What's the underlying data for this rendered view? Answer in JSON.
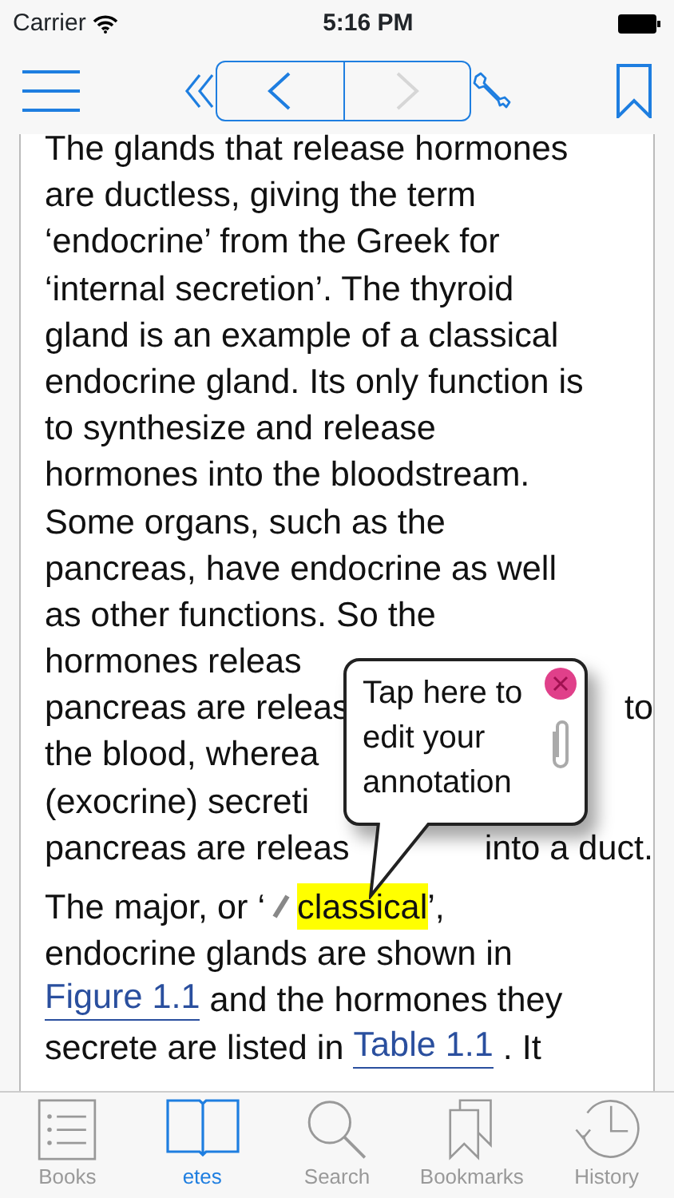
{
  "status_bar": {
    "carrier": "Carrier",
    "time": "5:16 PM"
  },
  "toolbar": {
    "back_button": {
      "disabled": false
    },
    "forward_button": {
      "disabled": true
    }
  },
  "article": {
    "paragraphs": [
      {
        "lines": [
          [
            {
              "kind": "text",
              "text": "The glands that release hormones"
            }
          ],
          [
            {
              "kind": "text",
              "text": "are ductless, giving the term"
            }
          ],
          [
            {
              "kind": "text",
              "text": "‘endocrine’ from the Greek for"
            }
          ],
          [
            {
              "kind": "text",
              "text": "‘internal secretion’. The thyroid"
            }
          ],
          [
            {
              "kind": "text",
              "text": "gland is an example of a classical"
            }
          ],
          [
            {
              "kind": "text",
              "text": "endocrine gland. Its only function is"
            }
          ],
          [
            {
              "kind": "text",
              "text": "to synthesize and release"
            }
          ],
          [
            {
              "kind": "text",
              "text": "hormones into the bloodstream."
            }
          ],
          [
            {
              "kind": "text",
              "text": "Some organs, such as the"
            }
          ],
          [
            {
              "kind": "text",
              "text": "pancreas, have endocrine as well"
            }
          ],
          [
            {
              "kind": "text",
              "text": "as other functions. So the"
            }
          ],
          [
            {
              "kind": "text",
              "text": "hormones releas"
            }
          ],
          [
            {
              "kind": "text",
              "text": "pancreas are releas"
            },
            {
              "kind": "gap"
            },
            {
              "kind": "text",
              "text": "to"
            }
          ],
          [
            {
              "kind": "text",
              "text": "the blood, wherea"
            }
          ],
          [
            {
              "kind": "text",
              "text": "(exocrine) secreti"
            }
          ],
          [
            {
              "kind": "text",
              "text": "pancreas are releas"
            },
            {
              "kind": "gap"
            },
            {
              "kind": "text",
              "text": "into a duct."
            }
          ]
        ]
      },
      {
        "lines": [
          [
            {
              "kind": "text",
              "text": "The major, or ‘"
            },
            {
              "kind": "pencil"
            },
            {
              "kind": "highlight",
              "text": "classical"
            },
            {
              "kind": "text",
              "text": "’,"
            }
          ],
          [
            {
              "kind": "text",
              "text": "endocrine glands are shown in"
            }
          ],
          [
            {
              "kind": "link",
              "text": "Figure 1.1"
            },
            {
              "kind": "text",
              "text": " and the hormones they"
            }
          ],
          [
            {
              "kind": "text",
              "text": "secrete are listed in "
            },
            {
              "kind": "link",
              "text": "Table 1.1"
            },
            {
              "kind": "text",
              "text": " . It"
            }
          ]
        ]
      }
    ]
  },
  "popup": {
    "text": "Tap here to edit your annotation"
  },
  "tab_bar": [
    {
      "label": "Books",
      "selected": false
    },
    {
      "label": "etes",
      "selected": true
    },
    {
      "label": "Search",
      "selected": false
    },
    {
      "label": "Bookmarks",
      "selected": false
    },
    {
      "label": "History",
      "selected": false
    }
  ]
}
